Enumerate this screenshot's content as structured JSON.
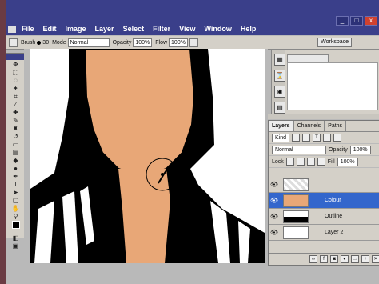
{
  "app": {
    "badge": "Ps"
  },
  "menu": [
    "File",
    "Edit",
    "Image",
    "Layer",
    "Select",
    "Filter",
    "View",
    "Window",
    "Help"
  ],
  "window_buttons": {
    "minimize": "_",
    "maximize": "□",
    "close": "x"
  },
  "options": {
    "brush_label": "Brush",
    "brush_size": "30",
    "mode_label": "Mode",
    "mode_value": "Normal",
    "opacity_label": "Opacity",
    "opacity_value": "100%",
    "flow_label": "Flow",
    "flow_value": "100%",
    "workspace_label": "Workspace"
  },
  "layers_panel": {
    "tabs": [
      "Layers",
      "Channels",
      "Paths"
    ],
    "kind_label": "Kind",
    "blend_mode": "Normal",
    "opacity_label": "Opacity",
    "opacity_value": "100%",
    "lock_label": "Lock",
    "fill_label": "Fill",
    "fill_value": "100%",
    "layers": [
      {
        "name": "",
        "selected": false
      },
      {
        "name": "Colour",
        "selected": true
      },
      {
        "name": "Outline",
        "selected": false
      },
      {
        "name": "Layer 2",
        "selected": false
      }
    ]
  },
  "colors": {
    "menu_bg": "#3a3f8a",
    "skin": "#e8a777",
    "selected_layer": "#3366cc",
    "close_btn": "#d0412f"
  },
  "icons": [
    "brush-icon",
    "eye-icon",
    "lock-icon",
    "trash-icon",
    "new-layer-icon",
    "folder-icon",
    "link-icon",
    "fx-icon",
    "mask-icon"
  ]
}
